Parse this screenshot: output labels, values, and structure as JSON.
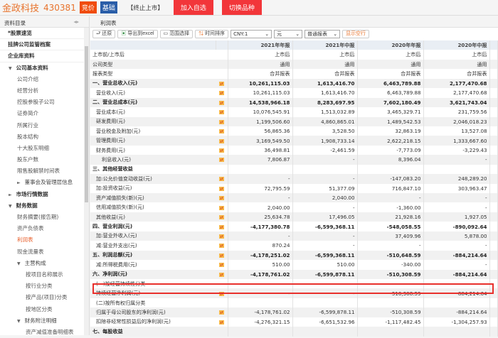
{
  "header": {
    "stock_name": "金政科技",
    "stock_code": "430381",
    "badge_bid": "竞价",
    "badge_basic": "基础",
    "status": "【终止上市】",
    "add_watch": "加入自选",
    "switch": "切换品种"
  },
  "sidebar": {
    "title": "资料目录",
    "items": [
      {
        "label": "*股票速览",
        "level": "l0"
      },
      {
        "label": "挂牌公司监管档案",
        "level": "l0"
      },
      {
        "label": "企业库资料",
        "level": "l0"
      },
      {
        "label": "公司基本资料",
        "level": "l1",
        "tri": "▼"
      },
      {
        "label": "公司介绍",
        "level": "l2"
      },
      {
        "label": "经营分析",
        "level": "l2"
      },
      {
        "label": "控股参股子公司",
        "level": "l2"
      },
      {
        "label": "证券简介",
        "level": "l2"
      },
      {
        "label": "所属行业",
        "level": "l2"
      },
      {
        "label": "股本结构",
        "level": "l2"
      },
      {
        "label": "十大股东明细",
        "level": "l2"
      },
      {
        "label": "股东户数",
        "level": "l2"
      },
      {
        "label": "限售股解禁时间表",
        "level": "l2"
      },
      {
        "label": "董事会及管理层信息",
        "level": "l2b",
        "tri": "►"
      },
      {
        "label": "市场行情数据",
        "level": "l1",
        "tri": "►"
      },
      {
        "label": "财务数据",
        "level": "l1",
        "tri": "▼"
      },
      {
        "label": "财务摘要(报告期)",
        "level": "l2"
      },
      {
        "label": "资产负债表",
        "level": "l2"
      },
      {
        "label": "利润表",
        "level": "l2",
        "active": true
      },
      {
        "label": "现金流量表",
        "level": "l2"
      },
      {
        "label": "主营构成",
        "level": "l2b",
        "tri": "▼"
      },
      {
        "label": "按项目名称展示",
        "level": "l3"
      },
      {
        "label": "按行业分类",
        "level": "l3"
      },
      {
        "label": "按产品(项目)分类",
        "level": "l3"
      },
      {
        "label": "按地区分类",
        "level": "l3"
      },
      {
        "label": "财务附注明细",
        "level": "l2b",
        "tri": "▼"
      },
      {
        "label": "资产减值准备明细表",
        "level": "l3"
      }
    ]
  },
  "tab": {
    "label": "利润表"
  },
  "toolbar": {
    "restore": "还原",
    "export": "导出到excel",
    "range": "范围选择",
    "sort": "时间排序",
    "currency": "CNY:1",
    "unit": "元",
    "report_type": "普通报表",
    "show_empty": "显示空行"
  },
  "table": {
    "columns": [
      "2021年年报",
      "2021年中报",
      "2020年年报",
      "2020年中报"
    ],
    "rows": [
      {
        "label": "上市前/上市后",
        "v": [
          "上市后",
          "上市后",
          "上市后",
          "上市后"
        ]
      },
      {
        "label": "公司类型",
        "v": [
          "通用",
          "通用",
          "通用",
          "通用"
        ]
      },
      {
        "label": "报表类型",
        "v": [
          "合并报表",
          "合并报表",
          "合并报表",
          "合并报表"
        ]
      },
      {
        "label": "一、营业总收入(元)",
        "bold": true,
        "icon": true,
        "v": [
          "10,261,115.03",
          "1,613,416.70",
          "6,463,789.88",
          "2,177,470.68"
        ]
      },
      {
        "label": "营业收入(元)",
        "ind": 1,
        "icon": true,
        "v": [
          "10,261,115.03",
          "1,613,416.70",
          "6,463,789.88",
          "2,177,470.68"
        ]
      },
      {
        "label": "二、营业总成本(元)",
        "bold": true,
        "icon": true,
        "v": [
          "14,538,966.18",
          "8,283,697.95",
          "7,602,180.49",
          "3,621,743.04"
        ]
      },
      {
        "label": "营业成本(元)",
        "ind": 1,
        "icon": true,
        "v": [
          "10,076,545.91",
          "1,513,032.89",
          "3,465,329.71",
          "231,759.56"
        ]
      },
      {
        "label": "研发费用(元)",
        "ind": 1,
        "icon": true,
        "v": [
          "1,199,506.60",
          "4,860,865.01",
          "1,489,542.53",
          "2,046,018.23"
        ]
      },
      {
        "label": "营业税金及附加(元)",
        "ind": 1,
        "icon": true,
        "v": [
          "56,865.36",
          "3,528.50",
          "32,863.19",
          "13,527.08"
        ]
      },
      {
        "label": "管理费用(元)",
        "ind": 1,
        "icon": true,
        "v": [
          "3,169,549.50",
          "1,908,733.14",
          "2,622,218.15",
          "1,333,667.60"
        ]
      },
      {
        "label": "财务费用(元)",
        "ind": 1,
        "icon": true,
        "v": [
          "36,498.81",
          "-2,461.59",
          "-7,773.09",
          "-3,229.43"
        ]
      },
      {
        "label": "利息收入(元)",
        "ind": 2,
        "icon": true,
        "v": [
          "7,806.87",
          "-",
          "8,396.04",
          "-"
        ]
      },
      {
        "label": "三、其他经营收益",
        "bold": true,
        "v": [
          "",
          "",
          "",
          ""
        ]
      },
      {
        "label": "加:公允价值变动收益(元)",
        "ind": 1,
        "icon": true,
        "v": [
          "-",
          "-",
          "-147,083.20",
          "248,289.20"
        ]
      },
      {
        "label": "加:投资收益(元)",
        "ind": 1,
        "icon": true,
        "v": [
          "72,795.59",
          "51,377.09",
          "716,847.10",
          "303,963.47"
        ]
      },
      {
        "label": "资产减值损失(新)(元)",
        "ind": 1,
        "icon": true,
        "v": [
          "-",
          "2,040.00",
          "-",
          "-"
        ]
      },
      {
        "label": "信用减值损失(新)(元)",
        "ind": 1,
        "icon": true,
        "v": [
          "2,040.00",
          "-",
          "-1,360.00",
          "-"
        ]
      },
      {
        "label": "其他收益(元)",
        "ind": 1,
        "icon": true,
        "v": [
          "25,634.78",
          "17,496.05",
          "21,928.16",
          "1,927.05"
        ]
      },
      {
        "label": "四、营业利润(元)",
        "bold": true,
        "icon": true,
        "v": [
          "-4,177,380.78",
          "-6,599,368.11",
          "-548,058.55",
          "-890,092.64"
        ]
      },
      {
        "label": "加:营业外收入(元)",
        "ind": 1,
        "icon": true,
        "v": [
          "-",
          "-",
          "37,409.96",
          "5,878.00"
        ]
      },
      {
        "label": "减:营业外支出(元)",
        "ind": 1,
        "icon": true,
        "v": [
          "870.24",
          "-",
          "-",
          "-"
        ]
      },
      {
        "label": "五、利润总额(元)",
        "bold": true,
        "icon": true,
        "v": [
          "-4,178,251.02",
          "-6,599,368.11",
          "-510,648.59",
          "-884,214.64"
        ]
      },
      {
        "label": "减:所得税费用(元)",
        "ind": 1,
        "icon": true,
        "v": [
          "510.00",
          "510.00",
          "-340.00",
          "-"
        ]
      },
      {
        "label": "六、净利润(元)",
        "bold": true,
        "icon": true,
        "v": [
          "-4,178,761.02",
          "-6,599,878.11",
          "-510,308.59",
          "-884,214.64"
        ]
      },
      {
        "label": "(一)按经营持续性分类",
        "ind": 1,
        "v": [
          "",
          "",
          "",
          ""
        ]
      },
      {
        "label": "持续经营净利润(元)",
        "ind": 1,
        "icon": true,
        "v": [
          "-",
          "-",
          "-510,308.59",
          "-884,214.64"
        ]
      },
      {
        "label": "(二)按所有权归属分类",
        "ind": 1,
        "v": [
          "",
          "",
          "",
          ""
        ]
      },
      {
        "label": "归属于母公司股东的净利润(元)",
        "ind": 1,
        "icon": true,
        "v": [
          "-4,178,761.02",
          "-6,599,878.11",
          "-510,308.59",
          "-884,214.64"
        ]
      },
      {
        "label": "扣除非经常性损益后的净利润(元)",
        "ind": 1,
        "icon": true,
        "v": [
          "-4,276,321.15",
          "-6,651,532.96",
          "-1,117,482.45",
          "-1,304,257.93"
        ]
      },
      {
        "label": "七、每股收益",
        "bold": true,
        "v": [
          "",
          "",
          "",
          ""
        ]
      }
    ]
  }
}
